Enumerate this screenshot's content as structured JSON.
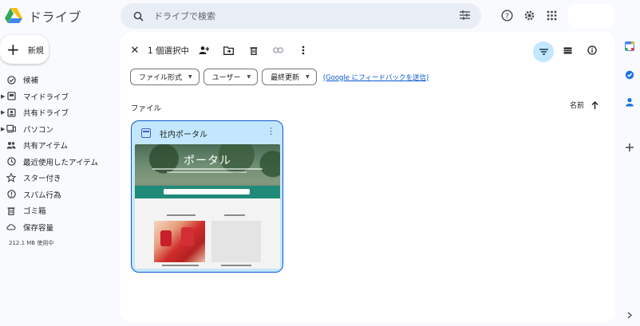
{
  "app": {
    "title": "ドライブ"
  },
  "search": {
    "placeholder": "ドライブで検索"
  },
  "sidebar": {
    "new_label": "新規",
    "items": [
      {
        "label": "候補",
        "icon": "check-circle-icon",
        "has_caret": false
      },
      {
        "label": "マイドライブ",
        "icon": "my-drive-icon",
        "has_caret": true
      },
      {
        "label": "共有ドライブ",
        "icon": "shared-drive-icon",
        "has_caret": true
      },
      {
        "label": "パソコン",
        "icon": "computer-icon",
        "has_caret": true
      },
      {
        "label": "共有アイテム",
        "icon": "people-icon",
        "has_caret": false
      },
      {
        "label": "最近使用したアイテム",
        "icon": "clock-icon",
        "has_caret": false
      },
      {
        "label": "スター付き",
        "icon": "star-icon",
        "has_caret": false
      },
      {
        "label": "スパム行為",
        "icon": "spam-icon",
        "has_caret": false
      },
      {
        "label": "ゴミ箱",
        "icon": "trash-icon",
        "has_caret": false
      },
      {
        "label": "保存容量",
        "icon": "cloud-icon",
        "has_caret": false
      }
    ],
    "storage_used": "212.1 MB 使用中"
  },
  "selection": {
    "count_label": "1 個選択中"
  },
  "filters": {
    "chips": [
      {
        "label": "ファイル形式"
      },
      {
        "label": "ユーザー"
      },
      {
        "label": "最終更新"
      }
    ],
    "feedback_link": "(Google にフィードバックを送信)"
  },
  "files_section": {
    "title": "ファイル",
    "sort_label": "名前"
  },
  "file_card": {
    "name": "社内ポータル",
    "preview": {
      "hero_title": "ポータル"
    }
  },
  "colors": {
    "accent": "#0b57d0",
    "selected_bg": "#c2e7ff",
    "background": "#f8fafd"
  }
}
